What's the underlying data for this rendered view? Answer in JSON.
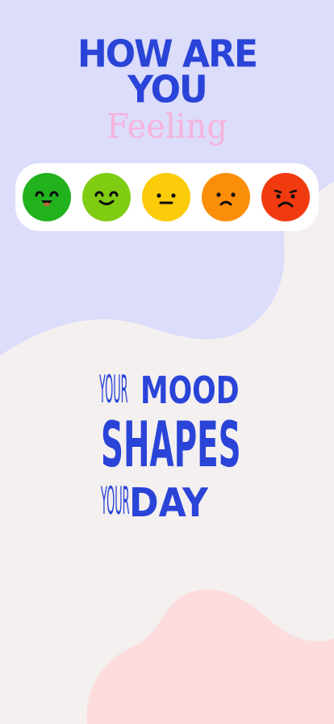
{
  "header": {
    "line1": "HOW ARE",
    "line2": "YOU",
    "line3": "Feeling"
  },
  "moods": [
    {
      "icon": "very-happy-face-icon",
      "color": "#22b21e"
    },
    {
      "icon": "happy-face-icon",
      "color": "#7fcc12"
    },
    {
      "icon": "neutral-face-icon",
      "color": "#fccb0a"
    },
    {
      "icon": "sad-face-icon",
      "color": "#fb8e08"
    },
    {
      "icon": "very-sad-face-icon",
      "color": "#f23a10"
    }
  ],
  "slogan": {
    "your_1": "YOUR",
    "mood": "MOOD",
    "shapes": "SHAPES",
    "your_2": "YOUR",
    "day": "DAY"
  },
  "colors": {
    "accent": "#2a44d8",
    "pink": "#f5b3dc",
    "lavender": "#dcdcfb",
    "peach": "#fcdcdc",
    "page": "#f4f0f0"
  }
}
